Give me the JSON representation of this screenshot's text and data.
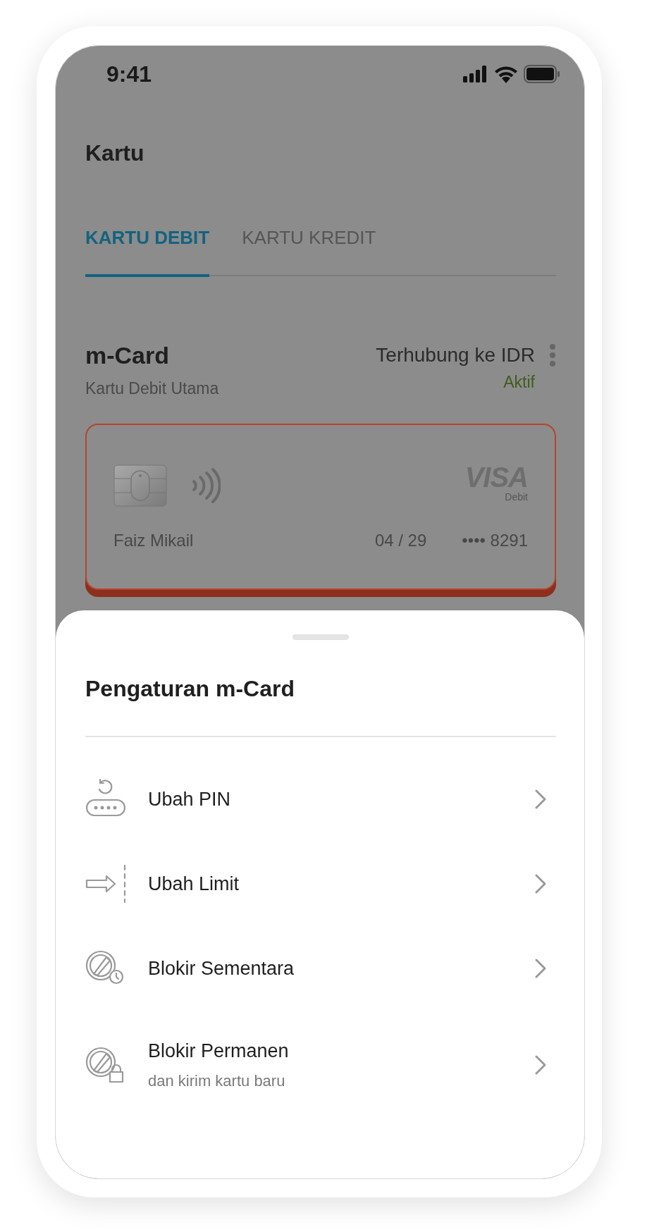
{
  "status_bar": {
    "time": "9:41"
  },
  "header": {
    "title": "Kartu"
  },
  "tabs": [
    {
      "label": "KARTU DEBIT",
      "selected": true
    },
    {
      "label": "KARTU KREDIT",
      "selected": false
    }
  ],
  "card_section": {
    "name": "m-Card",
    "subtitle": "Kartu Debit Utama",
    "linked_account": "Terhubung ke IDR",
    "status": "Aktif",
    "card": {
      "network": "VISA",
      "type": "Debit",
      "holder": "Faiz Mikail",
      "expiry": "04 / 29",
      "number": "•••• 8291"
    }
  },
  "sheet": {
    "title": "Pengaturan m-Card",
    "items": [
      {
        "kind": "pin",
        "label": "Ubah PIN"
      },
      {
        "kind": "limit",
        "label": "Ubah Limit"
      },
      {
        "kind": "temp-block",
        "label": "Blokir Sementara"
      },
      {
        "kind": "perm-block",
        "label": "Blokir Permanen",
        "subtitle": "dan kirim kartu baru"
      }
    ]
  }
}
